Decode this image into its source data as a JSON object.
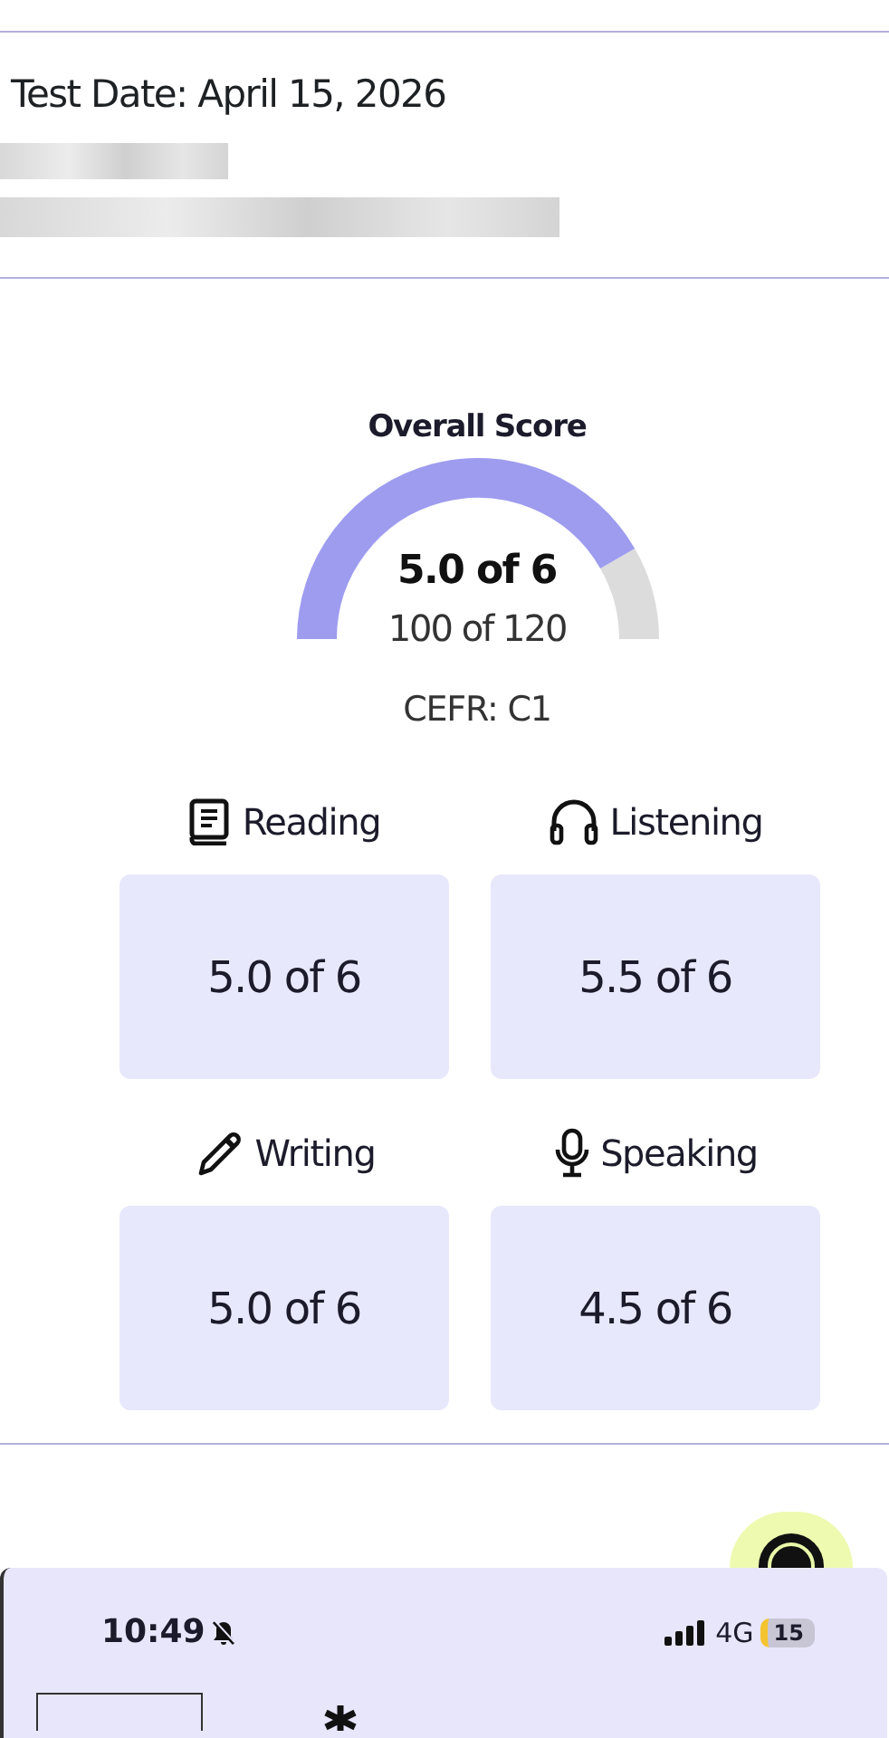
{
  "header": {
    "test_date": "Test Date: April 15, 2026"
  },
  "overall": {
    "title": "Overall Score",
    "score": "5.0 of 6",
    "total": "100 of 120",
    "cefr": "CEFR: C1"
  },
  "sections": [
    {
      "kind": "reading",
      "label": "Reading",
      "score": "5.0 of 6"
    },
    {
      "kind": "listening",
      "label": "Listening",
      "score": "5.5 of 6"
    },
    {
      "kind": "writing",
      "label": "Writing",
      "score": "5.0 of 6"
    },
    {
      "kind": "speaking",
      "label": "Speaking",
      "score": "4.5 of 6"
    }
  ],
  "status_bar": {
    "time": "10:49",
    "network": "4G",
    "battery": "15"
  }
}
